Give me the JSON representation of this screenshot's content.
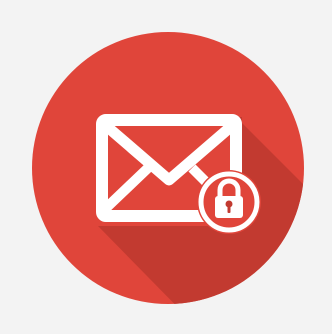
{
  "colors": {
    "background": "#f3f3f3",
    "circle": "#e0453a",
    "circle_shadow": "#c23a30",
    "envelope": "#ffffff",
    "lock": "#ffffff",
    "keyhole": "#c23a30"
  },
  "icon": {
    "main": "mail-lock-icon",
    "parts": [
      "envelope-icon",
      "padlock-icon"
    ]
  }
}
